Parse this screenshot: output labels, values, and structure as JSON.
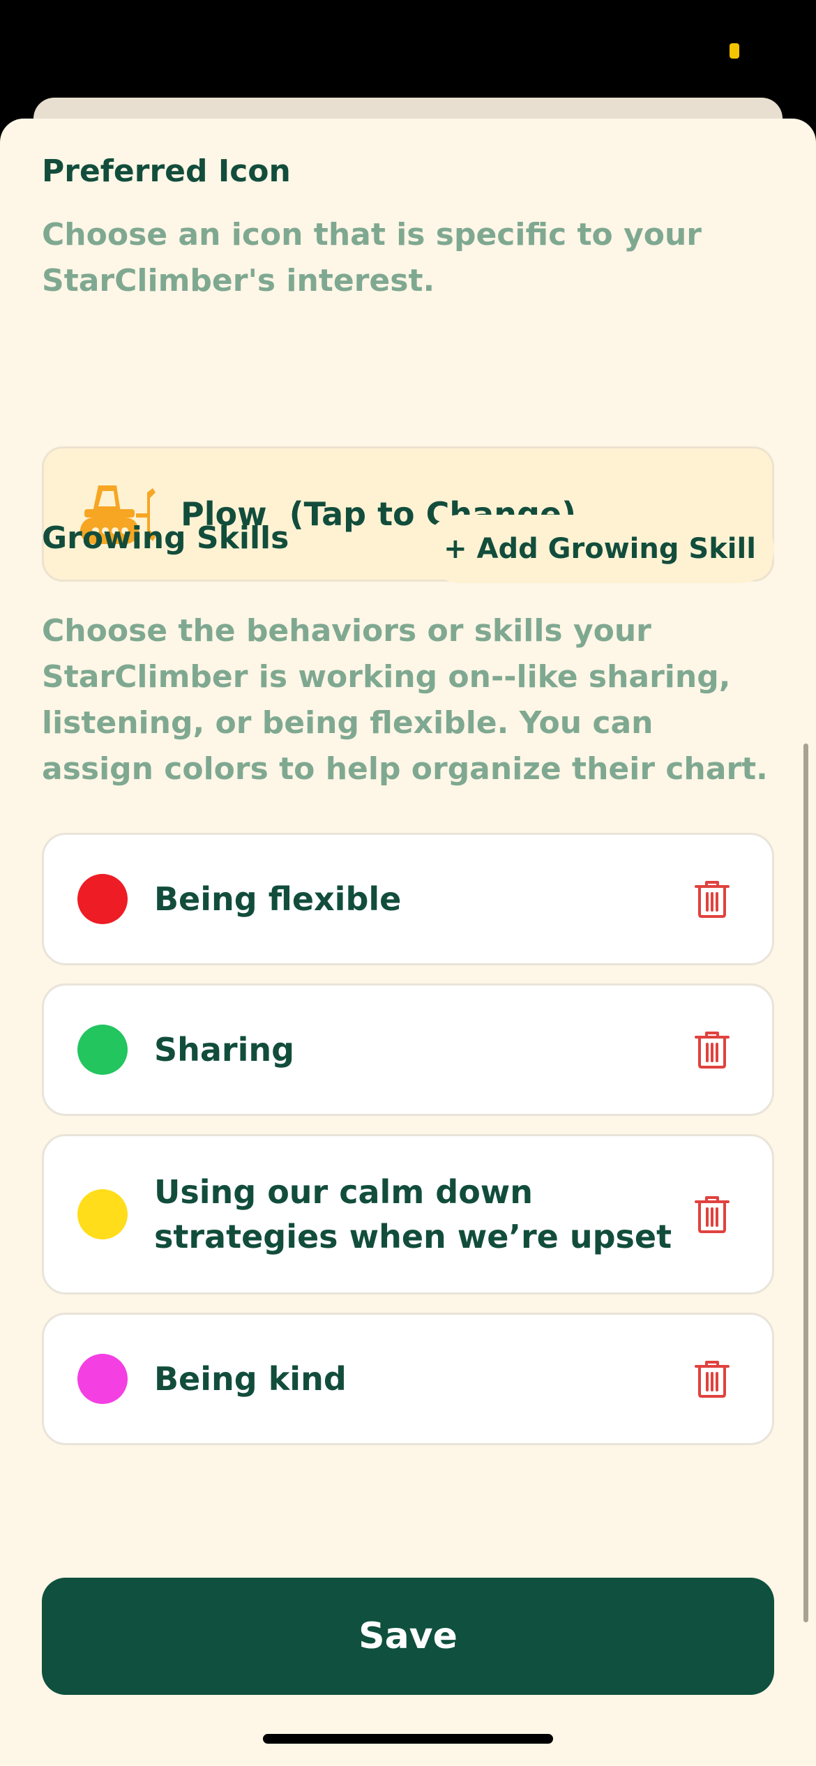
{
  "colors": {
    "background": "#FEF6E6",
    "primary": "#0F503E",
    "muted_text": "#7FA891",
    "highlight": "#FFF2D3",
    "danger": "#E0423F"
  },
  "preferred_icon": {
    "title": "Preferred Icon",
    "description": "Choose an icon that is specific to your StarClimber's interest.",
    "selected_icon": "plow-icon",
    "selected_label": "Plow  (Tap to Change)"
  },
  "growing_skills": {
    "title": "Growing Skills",
    "add_button_label": "+ Add Growing Skill",
    "description": "Choose the behaviors or skills your StarClimber is working on--like sharing, listening, or being flexible. You can assign colors to help organize their chart.",
    "items": [
      {
        "label": "Being flexible",
        "color": "#EE1C25",
        "icon": "trash-icon"
      },
      {
        "label": "Sharing",
        "color": "#22C55E",
        "icon": "trash-icon"
      },
      {
        "label": "Using our calm down strategies when we’re upset",
        "color": "#FFDD1A",
        "icon": "trash-icon"
      },
      {
        "label": "Being kind",
        "color": "#F43FE3",
        "icon": "trash-icon"
      }
    ]
  },
  "footer": {
    "save_label": "Save"
  }
}
